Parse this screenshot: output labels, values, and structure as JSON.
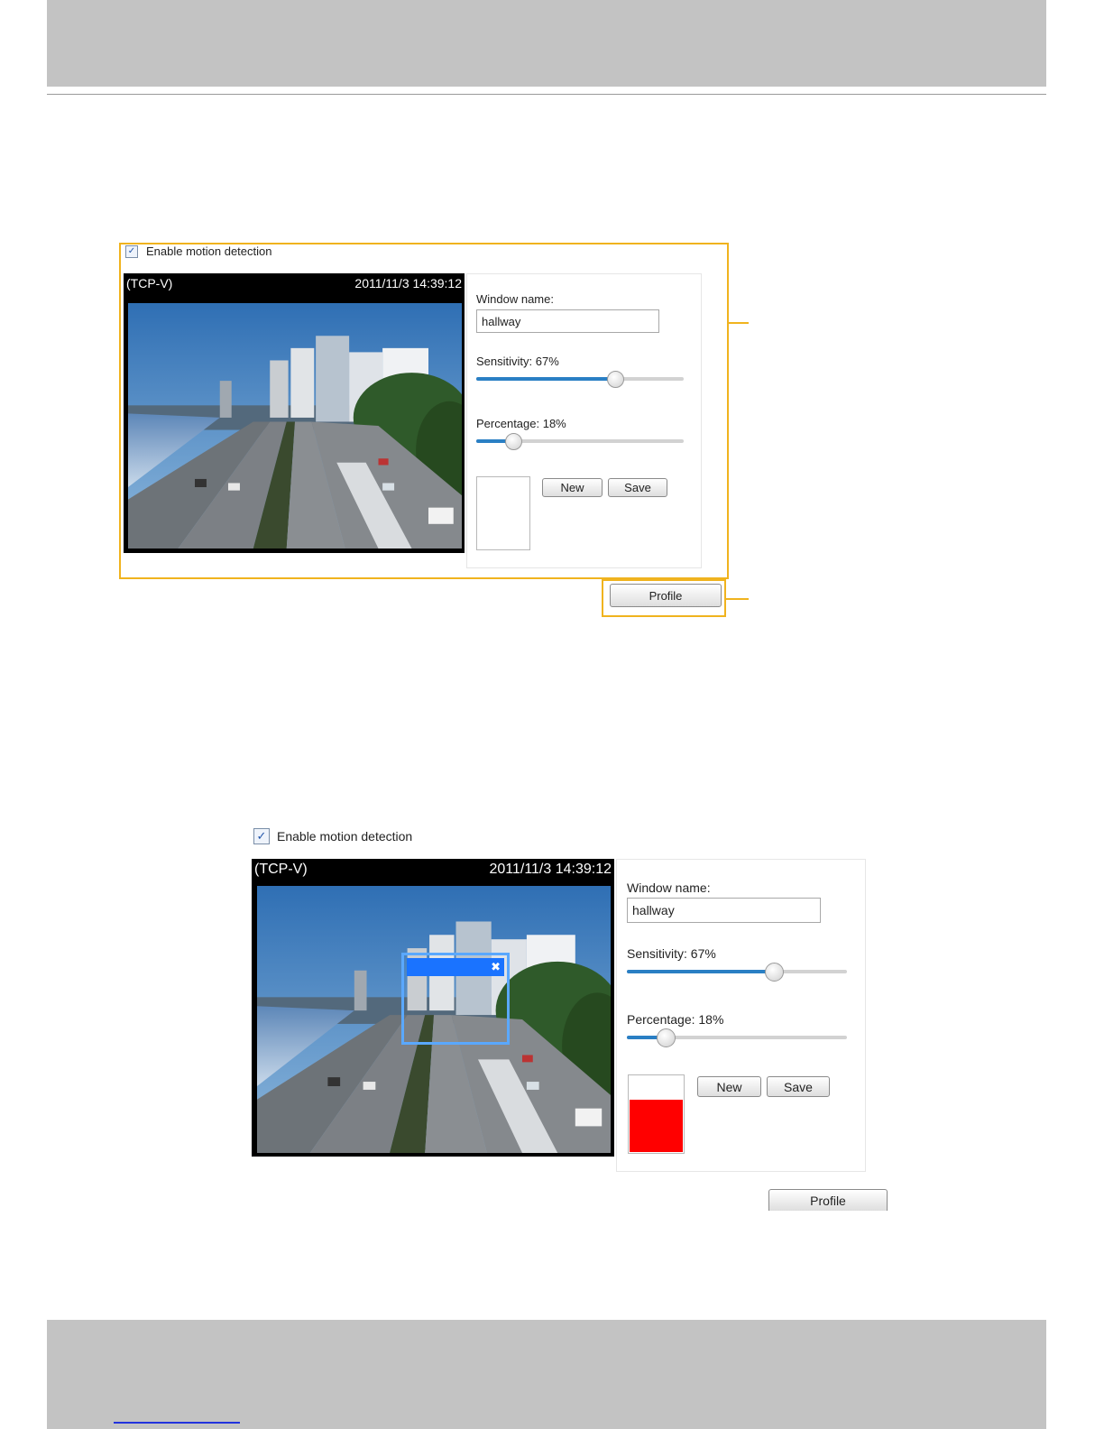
{
  "shot1": {
    "enable_label": "Enable motion detection",
    "video_label": "(TCP-V)",
    "timestamp": "2011/11/3 14:39:12",
    "window_name_label": "Window name:",
    "window_name_value": "hallway",
    "sensitivity_label": "Sensitivity: 67%",
    "sensitivity_value": 67,
    "percentage_label": "Percentage: 18%",
    "percentage_value": 18,
    "new_label": "New",
    "save_label": "Save",
    "profile_label": "Profile"
  },
  "shot2": {
    "enable_label": "Enable motion detection",
    "video_label": "(TCP-V)",
    "timestamp": "2011/11/3 14:39:12",
    "window_name_label": "Window name:",
    "window_name_value": "hallway",
    "sensitivity_label": "Sensitivity: 67%",
    "sensitivity_value": 67,
    "percentage_label": "Percentage: 18%",
    "percentage_value": 18,
    "new_label": "New",
    "save_label": "Save",
    "profile_label": "Profile",
    "motion_level_color": "#ff0000",
    "motion_window_close": "✖"
  },
  "colors": {
    "callout": "#f0b31e",
    "slider_fill": "#2a7fc4",
    "motion_window": "#1a73ff"
  }
}
